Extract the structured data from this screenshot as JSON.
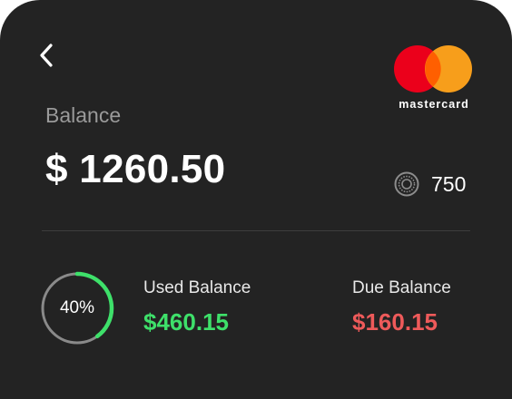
{
  "header": {
    "back_icon": "chevron-left-icon",
    "brand": {
      "name": "mastercard",
      "left_circle_color": "#eb001b",
      "right_circle_color": "#f79e1b",
      "overlap_color": "#ff5f00"
    }
  },
  "balance": {
    "label": "Balance",
    "amount": "$ 1260.50"
  },
  "points": {
    "icon": "coin-icon",
    "value": "750"
  },
  "usage": {
    "percent_text": "40%",
    "percent_value": 40,
    "track_color": "#8a8a8a",
    "progress_color": "#3ee06a",
    "used": {
      "label": "Used Balance",
      "amount": "$460.15",
      "color": "#3ee06a"
    },
    "due": {
      "label": "Due Balance",
      "amount": "$160.15",
      "color": "#ee5a5a"
    }
  }
}
